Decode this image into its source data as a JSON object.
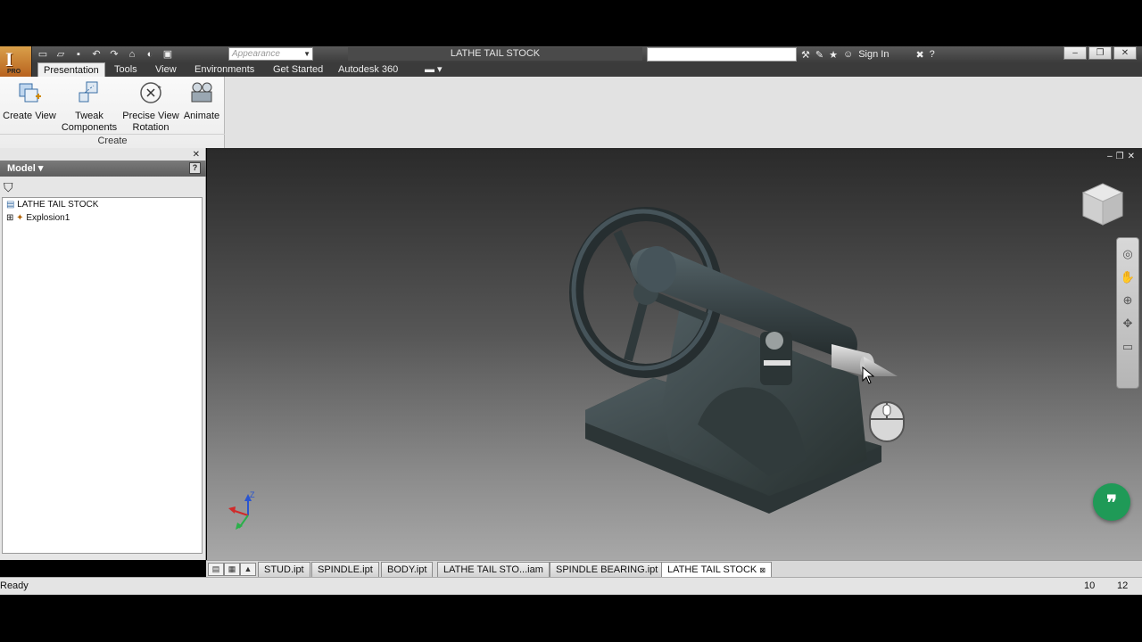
{
  "app": {
    "badge": "PRO",
    "document_title": "LATHE TAIL STOCK",
    "appearance_placeholder": "Appearance",
    "sign_in_label": "Sign In"
  },
  "ribbon": {
    "tabs": [
      {
        "label": "Presentation",
        "active": true
      },
      {
        "label": "Tools"
      },
      {
        "label": "View"
      },
      {
        "label": "Environments"
      },
      {
        "label": "Get Started"
      },
      {
        "label": "Autodesk 360"
      }
    ],
    "group_label": "Create",
    "buttons": {
      "create_view": "Create View",
      "tweak_line1": "Tweak",
      "tweak_line2": "Components",
      "precise_line1": "Precise View",
      "precise_line2": "Rotation",
      "animate": "Animate"
    }
  },
  "browser": {
    "header": "Model",
    "tree": [
      {
        "label": "LATHE TAIL STOCK"
      },
      {
        "label": "Explosion1"
      }
    ]
  },
  "document_tabs": [
    {
      "label": "STUD.ipt"
    },
    {
      "label": "SPINDLE.ipt"
    },
    {
      "label": "BODY.ipt"
    },
    {
      "label": "LATHE TAIL STO...iam"
    },
    {
      "label": "SPINDLE BEARING.ipt"
    },
    {
      "label": "LATHE TAIL STOCK",
      "active": true
    }
  ],
  "triad_axis_label": "Z",
  "status": {
    "text": "Ready",
    "value1": "10",
    "value2": "12"
  },
  "colors": {
    "tab_bar": "#3b3b3b",
    "ribbon": "#e2e2e2",
    "model_body": "#3a4548",
    "accent_green": "#1f9a57"
  }
}
